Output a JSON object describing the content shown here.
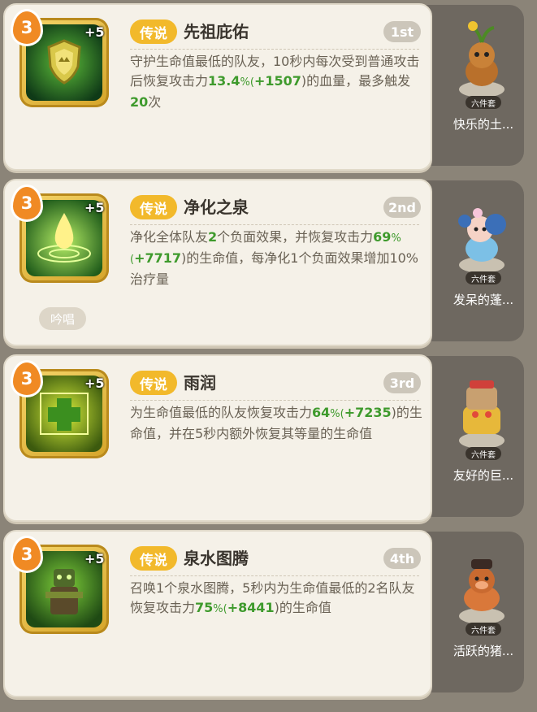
{
  "skills": [
    {
      "level": "3",
      "plus": "+5",
      "badge": "传说",
      "title": "先祖庇佑",
      "rank": "1st",
      "desc_parts": [
        "守护生命值最低的队友，10秒内每次受到普通攻击后恢复攻击力",
        "13.4",
        "%(",
        "+1507",
        ")的血量，最多触发",
        "20",
        "次"
      ],
      "pet_set_label": "六件套",
      "pet_name": "快乐的土..."
    },
    {
      "level": "3",
      "plus": "+5",
      "badge": "传说",
      "title": "净化之泉",
      "rank": "2nd",
      "desc_parts": [
        "净化全体队友",
        "2",
        "个负面效果，并恢复攻击力",
        "69",
        "%(",
        "+7717",
        ")的生命值，每净化1个负面效果增加10%治疗量"
      ],
      "tag": "吟唱",
      "pet_set_label": "六件套",
      "pet_name": "发呆的蓬..."
    },
    {
      "level": "3",
      "plus": "+5",
      "badge": "传说",
      "title": "雨润",
      "rank": "3rd",
      "desc_parts": [
        "为生命值最低的队友恢复攻击力",
        "64",
        "%(",
        "+7235",
        ")的生命值，并在5秒内额外恢复其等量的生命值"
      ],
      "pet_set_label": "六件套",
      "pet_name": "友好的巨..."
    },
    {
      "level": "3",
      "plus": "+5",
      "badge": "传说",
      "title": "泉水图腾",
      "rank": "4th",
      "desc_parts": [
        "召唤1个泉水图腾，5秒内为生命值最低的2名队友恢复攻击力",
        "75",
        "%(",
        "+8441",
        ")的生命值"
      ],
      "pet_set_label": "六件套",
      "pet_name": "活跃的猪..."
    }
  ],
  "colors": {
    "accent_gold": "#f2b92b",
    "highlight_green": "#3e9a2c",
    "level_orange": "#f08a24"
  }
}
